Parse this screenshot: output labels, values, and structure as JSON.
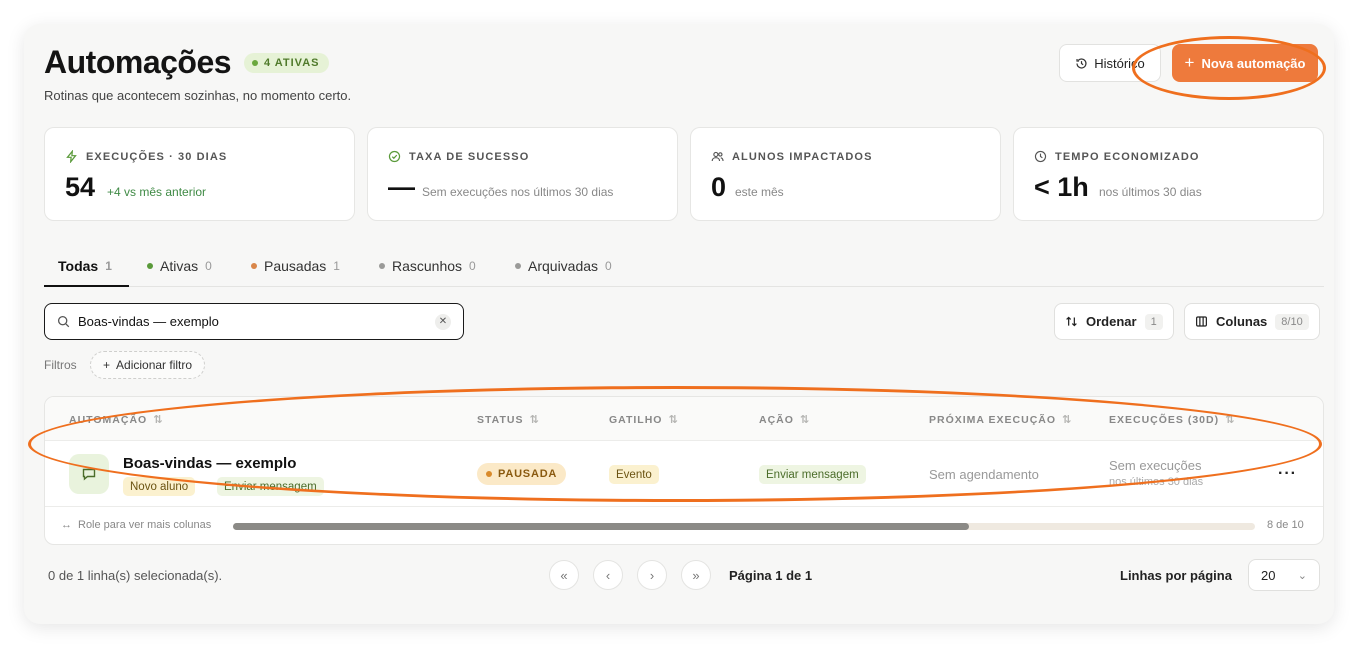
{
  "header": {
    "title": "Automações",
    "active_badge": "4 ATIVAS",
    "subtitle": "Rotinas que acontecem sozinhas, no momento certo.",
    "history_label": "Histórico",
    "new_label": "Nova automação"
  },
  "stats": [
    {
      "label": "EXECUÇÕES · 30 DIAS",
      "icon": "bolt-icon",
      "value": "54",
      "sub": "+4 vs mês anterior"
    },
    {
      "label": "TAXA DE SUCESSO",
      "icon": "check-circle-icon",
      "value": "—",
      "sub": "Sem execuções nos últimos 30 dias"
    },
    {
      "label": "ALUNOS IMPACTADOS",
      "icon": "users-icon",
      "value": "0",
      "sub": "este mês"
    },
    {
      "label": "TEMPO ECONOMIZADO",
      "icon": "clock-icon",
      "value": "< 1h",
      "sub": "nos últimos 30 dias"
    }
  ],
  "tabs": [
    {
      "label": "Todas",
      "count": "1"
    },
    {
      "label": "Ativas",
      "count": "0",
      "dot_color": "#5a9a3a"
    },
    {
      "label": "Pausadas",
      "count": "1",
      "dot_color": "#d9864a"
    },
    {
      "label": "Rascunhos",
      "count": "0",
      "dot_color": "#9a9a98"
    },
    {
      "label": "Arquivadas",
      "count": "0",
      "dot_color": "#9a9a98"
    }
  ],
  "search": {
    "value": "Boas-vindas — exemplo"
  },
  "toolbar": {
    "sort_label": "Ordenar",
    "sort_count": "1",
    "columns_label": "Colunas",
    "columns_count": "8/10"
  },
  "filters": {
    "label": "Filtros",
    "add_label": "Adicionar filtro"
  },
  "table": {
    "columns": [
      "AUTOMAÇÃO",
      "STATUS",
      "GATILHO",
      "AÇÃO",
      "PRÓXIMA EXECUÇÃO",
      "EXECUÇÕES (30D)"
    ],
    "row": {
      "name": "Boas-vindas — exemplo",
      "tags": [
        "Novo aluno",
        "Enviar mensagem"
      ],
      "status": "PAUSADA",
      "trigger": "Evento",
      "action": "Enviar mensagem",
      "next_run": "Sem agendamento",
      "executions": "Sem execuções",
      "executions_sub": "nos últimos 30 dias"
    },
    "scroll_hint": "Role para ver mais colunas",
    "scroll_count": "8 de 10",
    "scroll_fraction": 0.72
  },
  "footer": {
    "selected": "0 de 1 linha(s) selecionada(s).",
    "page": "Página 1 de 1",
    "rows_label": "Linhas por página",
    "rows_value": "20"
  },
  "colors": {
    "accent": "#ee7a3c",
    "annotation": "#ef6f1e"
  }
}
